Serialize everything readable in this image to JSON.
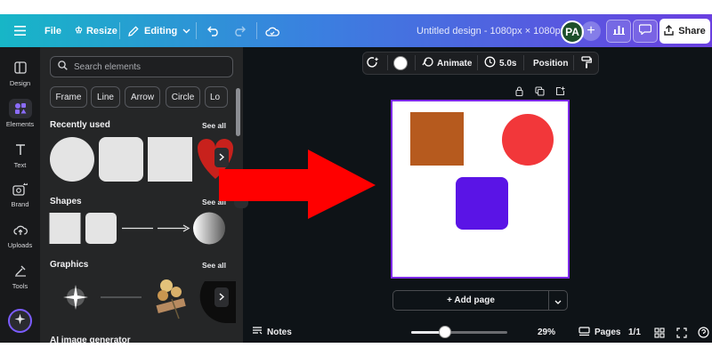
{
  "topbar": {
    "file_label": "File",
    "resize_label": "Resize",
    "editing_label": "Editing",
    "title": "Untitled design - 1080px × 1080px",
    "avatar_initials": "PA",
    "share_label": "Share"
  },
  "rail": {
    "items": [
      {
        "label": "Design",
        "icon": "design-icon"
      },
      {
        "label": "Elements",
        "icon": "elements-icon"
      },
      {
        "label": "Text",
        "icon": "text-icon"
      },
      {
        "label": "Brand",
        "icon": "brand-icon"
      },
      {
        "label": "Uploads",
        "icon": "uploads-icon"
      },
      {
        "label": "Tools",
        "icon": "tools-icon"
      }
    ],
    "active": "Elements"
  },
  "panel": {
    "search_placeholder": "Search elements",
    "chips": [
      "Frame",
      "Line",
      "Arrow",
      "Circle",
      "Lo"
    ],
    "sections": {
      "recent": "Recently used",
      "shapes": "Shapes",
      "graphics": "Graphics",
      "ai": "AI image generator"
    },
    "see_all": "See all"
  },
  "context_toolbar": {
    "animate_label": "Animate",
    "duration_label": "5.0s",
    "position_label": "Position"
  },
  "canvas": {
    "add_page_label": "+ Add page",
    "shapes": [
      {
        "kind": "square",
        "color": "#b65a1e"
      },
      {
        "kind": "circle",
        "color": "#f2373a"
      },
      {
        "kind": "rounded-square",
        "color": "#5a14e6"
      }
    ]
  },
  "bottombar": {
    "notes_label": "Notes",
    "zoom_label": "29%",
    "zoom_fraction": 0.35,
    "pages_label": "Pages",
    "page_counter": "1/1"
  },
  "colors": {
    "accent": "#7d2ae8",
    "arrow": "#ff0000"
  }
}
